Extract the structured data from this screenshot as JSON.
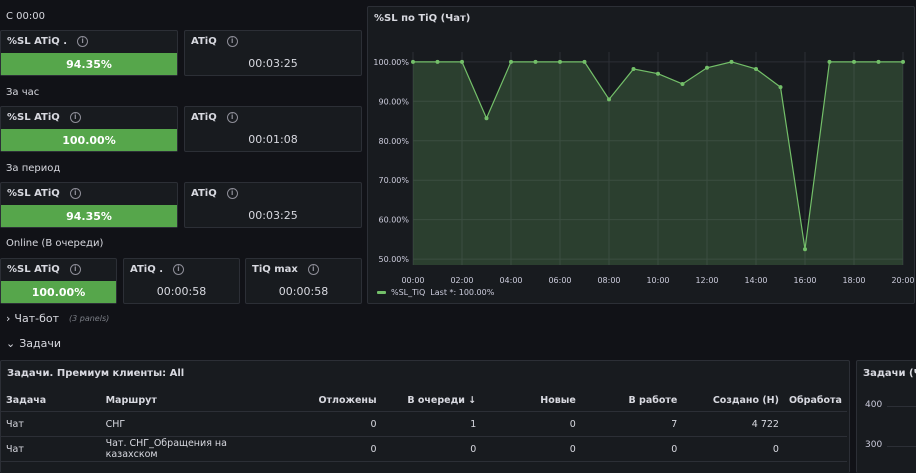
{
  "sections": {
    "since_midnight": "С 00:00",
    "per_hour": "За час",
    "per_period": "За период",
    "online": "Online (В очереди)"
  },
  "row1": {
    "sl_title": "%SL ATiQ .",
    "sl_value": "94.35%",
    "sl_fraction": 0.9435,
    "atiq_title": "ATiQ",
    "atiq_value": "00:03:25"
  },
  "row2": {
    "sl_title": "%SL ATiQ",
    "sl_value": "100.00%",
    "sl_fraction": 1.0,
    "atiq_title": "ATiQ",
    "atiq_value": "00:01:08"
  },
  "row3": {
    "sl_title": "%SL ATiQ",
    "sl_value": "94.35%",
    "sl_fraction": 0.9435,
    "atiq_title": "ATiQ",
    "atiq_value": "00:03:25"
  },
  "row4": {
    "sl_title": "%SL ATiQ",
    "sl_value": "100.00%",
    "sl_fraction": 1.0,
    "atiq_title": "ATiQ .",
    "atiq_value": "00:00:58",
    "tiqmax_title": "TiQ max",
    "tiqmax_value": "00:00:58"
  },
  "chart_panel": {
    "title": "%SL по TiQ (Чат)",
    "legend_label": "%SL_TiQ",
    "legend_stat": "Last *: 100.00%",
    "line_color": "#73bf69"
  },
  "chart_data": {
    "type": "area",
    "title": "%SL по TiQ (Чат)",
    "xlabel": "",
    "ylabel": "",
    "x_ticks": [
      "00:00",
      "02:00",
      "04:00",
      "06:00",
      "08:00",
      "10:00",
      "12:00",
      "14:00",
      "16:00",
      "18:00",
      "20:00"
    ],
    "y_ticks": [
      "50.00%",
      "60.00%",
      "70.00%",
      "80.00%",
      "90.00%",
      "100.00%"
    ],
    "ylim": [
      48.5,
      102.5
    ],
    "xlim": [
      0,
      20
    ],
    "series": [
      {
        "name": "%SL_TiQ",
        "x": [
          0,
          1,
          2,
          3,
          4,
          5,
          6,
          7,
          8,
          9,
          10,
          11,
          12,
          13,
          14,
          15,
          16,
          17,
          18,
          19,
          20
        ],
        "values": [
          100,
          100,
          100,
          85.7,
          100,
          100,
          100,
          100,
          90.5,
          98.2,
          97,
          94.4,
          98.5,
          100,
          98.2,
          93.6,
          52.5,
          100,
          100,
          100,
          100
        ]
      }
    ],
    "grid": true,
    "legend": "bottom-left"
  },
  "chatbot_row": {
    "title": "Чат-бот",
    "panels_note": "(3 panels)"
  },
  "tasks_row": {
    "title": "Задачи"
  },
  "tasks_table": {
    "title": "Задачи. Премиум клиенты: All",
    "columns": [
      "Задача",
      "Маршрут",
      "Отложены",
      "В очереди",
      "Новые",
      "В работе",
      "Создано (Н)",
      "Обработа"
    ],
    "sort_indicator": "↓",
    "rows": [
      [
        "Чат",
        "СНГ",
        "0",
        "1",
        "0",
        "7",
        "4 722",
        ""
      ],
      [
        "Чат",
        "Чат. СНГ_Обращения на казахском",
        "0",
        "0",
        "0",
        "0",
        "0",
        ""
      ]
    ]
  },
  "right_partial_panel": {
    "title": "Задачи (Чат",
    "y_ticks": [
      "400",
      "300"
    ]
  }
}
